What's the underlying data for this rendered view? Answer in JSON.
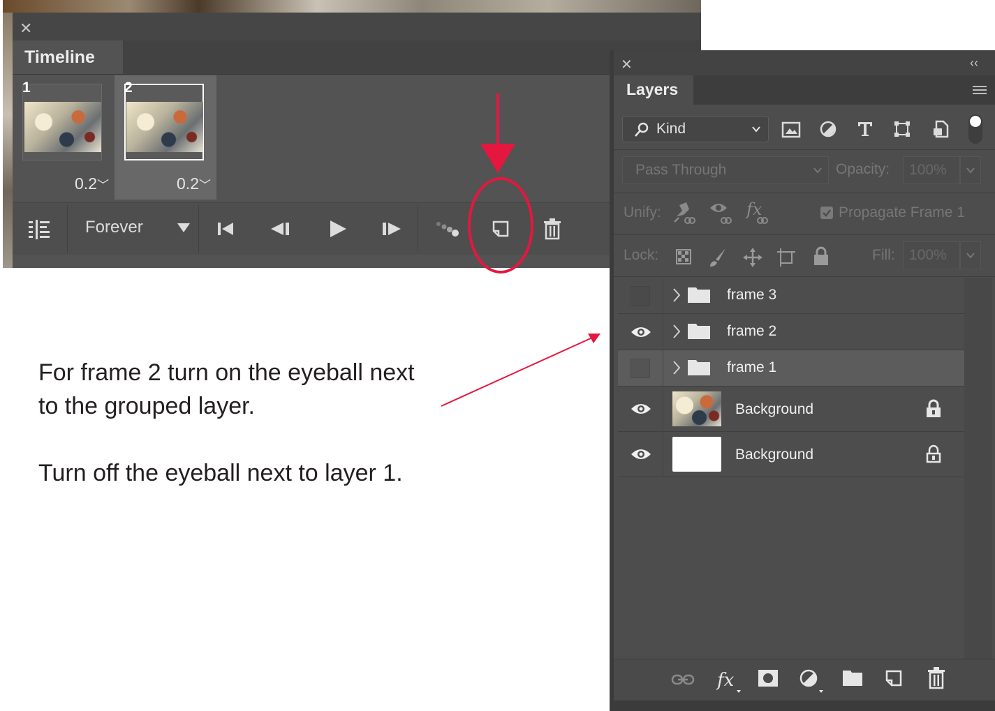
{
  "timeline": {
    "tab_label": "Timeline",
    "frames": [
      {
        "number": "1",
        "duration": "0.2"
      },
      {
        "number": "2",
        "duration": "0.2"
      }
    ],
    "loop_label": "Forever"
  },
  "layers": {
    "tab_label": "Layers",
    "filter_kind": "Kind",
    "blend_mode": "Pass Through",
    "opacity_label": "Opacity:",
    "opacity_value": "100%",
    "unify_label": "Unify:",
    "propagate_label": "Propagate Frame 1",
    "lock_label": "Lock:",
    "fill_label": "Fill:",
    "fill_value": "100%",
    "rows": [
      {
        "name": "frame 3",
        "visible": false
      },
      {
        "name": "frame 2",
        "visible": true
      },
      {
        "name": "frame 1",
        "visible": false
      },
      {
        "name": "Background",
        "visible": true
      },
      {
        "name": "Background",
        "visible": true
      }
    ]
  },
  "annotation": {
    "line1": "For frame 2 turn on the eyeball next",
    "line2": "to the grouped layer.",
    "line3": "Turn off the eyeball next to layer 1."
  },
  "colors": {
    "annotation_red": "#e5173f",
    "panel_bg": "#535353"
  }
}
